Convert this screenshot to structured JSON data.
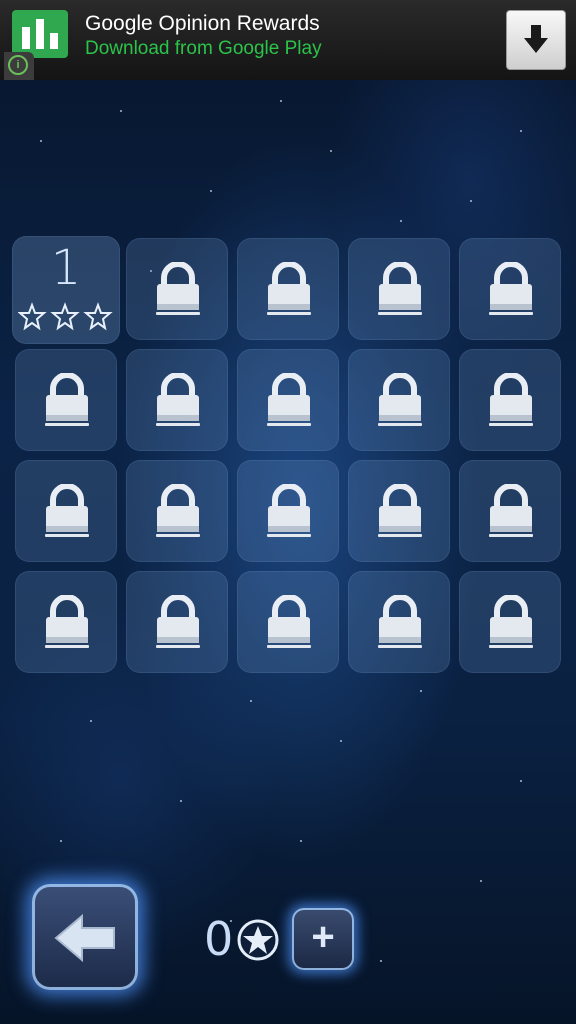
{
  "ad": {
    "title": "Google Opinion Rewards",
    "subtitle": "Download from Google Play",
    "badge": "i",
    "logo_icon": "bar-chart-icon",
    "download_icon": "download-arrow-icon"
  },
  "levels": [
    {
      "number": "1",
      "locked": false,
      "stars_earned": 0,
      "stars_total": 3
    },
    {
      "locked": true
    },
    {
      "locked": true
    },
    {
      "locked": true
    },
    {
      "locked": true
    },
    {
      "locked": true
    },
    {
      "locked": true
    },
    {
      "locked": true
    },
    {
      "locked": true
    },
    {
      "locked": true
    },
    {
      "locked": true
    },
    {
      "locked": true
    },
    {
      "locked": true
    },
    {
      "locked": true
    },
    {
      "locked": true
    },
    {
      "locked": true
    },
    {
      "locked": true
    },
    {
      "locked": true
    },
    {
      "locked": true
    },
    {
      "locked": true
    }
  ],
  "footer": {
    "star_count": "0",
    "plus_label": "+",
    "back_icon": "back-arrow-icon",
    "coin_icon": "star-coin-icon"
  },
  "colors": {
    "ad_green": "#2bc34a",
    "glow_blue": "#50a0ff"
  }
}
